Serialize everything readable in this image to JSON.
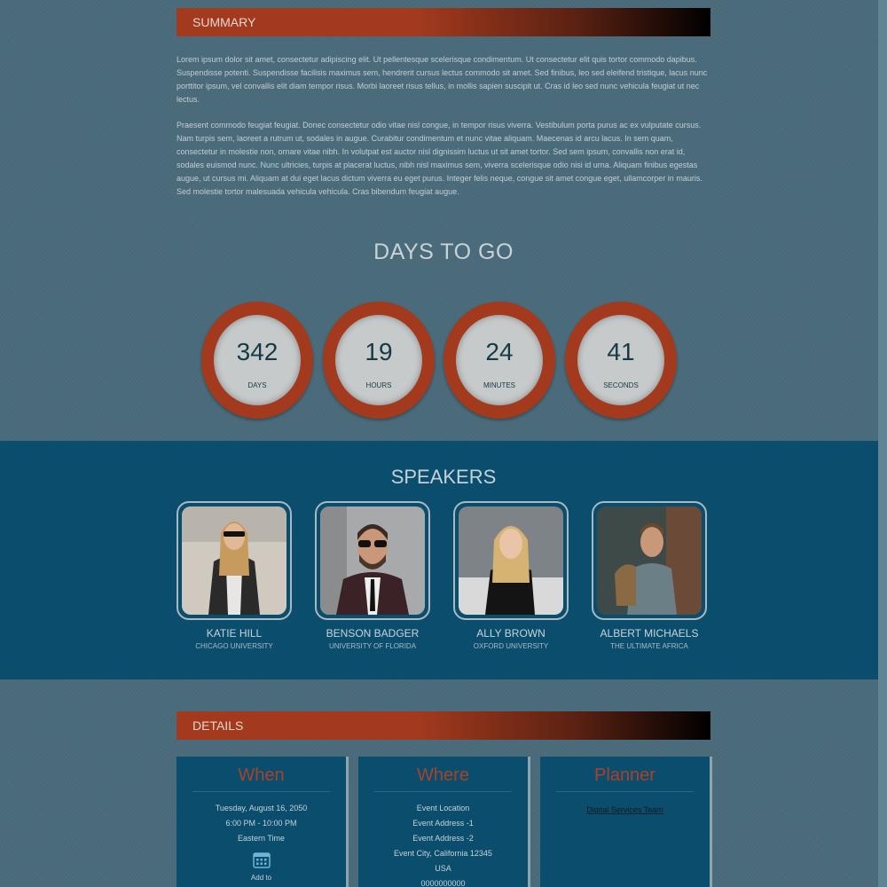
{
  "summary": {
    "header": "SUMMARY",
    "paragraph1": "Lorem ipsum dolor sit amet, consectetur adipiscing elit. Ut pellentesque scelerisque condimentum. Ut consectetur elit quis tortor commodo dapibus. Suspendisse potenti. Suspendisse facilisis maximus sem, hendrerit cursus lectus commodo sit amet. Sed finibus, leo sed eleifend tristique, lacus nunc porttitor ipsum, vel convallis elit diam tempor risus. Morbi laoreet risus tellus, in mollis sapien suscipit ut. Cras id leo sed nunc vehicula feugiat ut nec lectus.",
    "paragraph2": "Praesent commodo feugiat feugiat. Donec consectetur odio vitae nisl congue, in tempor risus viverra. Vestibulum porta purus ac ex vulputate cursus. Nam turpis sem, laoreet a rutrum ut, sodales in augue. Curabitur condimentum et nunc vitae aliquam. Maecenas id arcu lacus. In sem quam, consectetur in molestie non, ornare vitae nibh. In volutpat est auctor nisl dignissim luctus ut sit amet tortor. Sed sem ipsum, convallis non erat id, sodales euismod nunc. Nunc ultricies, turpis at placerat luctus, nibh nisl maximus sem, viverra scelerisque odio nisi id urna. Aliquam finibus egestas augue, ut cursus mi. Aliquam at dui eget lacus dictum viverra eu eget purus. Integer felis neque, congue sit amet congue eget, ullamcorper in mauris. Sed molestie tortor malesuada vehicula vehicula. Cras bibendum feugiat augue."
  },
  "countdown": {
    "title": "DAYS TO GO",
    "items": [
      {
        "value": "342",
        "label": "DAYS"
      },
      {
        "value": "19",
        "label": "HOURS"
      },
      {
        "value": "24",
        "label": "MINUTES"
      },
      {
        "value": "41",
        "label": "SECONDS"
      }
    ]
  },
  "speakers": {
    "title": "SPEAKERS",
    "items": [
      {
        "name": "KATIE HILL",
        "org": "CHICAGO UNIVERSITY"
      },
      {
        "name": "BENSON BADGER",
        "org": "UNIVERSITY OF FLORIDA"
      },
      {
        "name": "ALLY BROWN",
        "org": "OXFORD UNIVERSITY"
      },
      {
        "name": "ALBERT MICHAELS",
        "org": "THE ULTIMATE AFRICA"
      }
    ]
  },
  "details": {
    "header": "DETAILS",
    "when": {
      "title": "When",
      "date": "Tuesday, August 16, 2050",
      "time": "6:00 PM - 10:00 PM",
      "zone": "Eastern Time",
      "add_label": "Add to",
      "icon": "calendar-icon"
    },
    "where": {
      "title": "Where",
      "location": "Event Location",
      "address1": "Event Address -1",
      "address2": "Event Address -2",
      "city": "Event City, California 12345",
      "country": "USA",
      "phone": "0000000000"
    },
    "planner": {
      "title": "Planner",
      "link": "Digital Services Team"
    }
  },
  "colors": {
    "accent": "#a33a1d",
    "background": "#4a6b7b",
    "band": "#0b4d6d"
  }
}
